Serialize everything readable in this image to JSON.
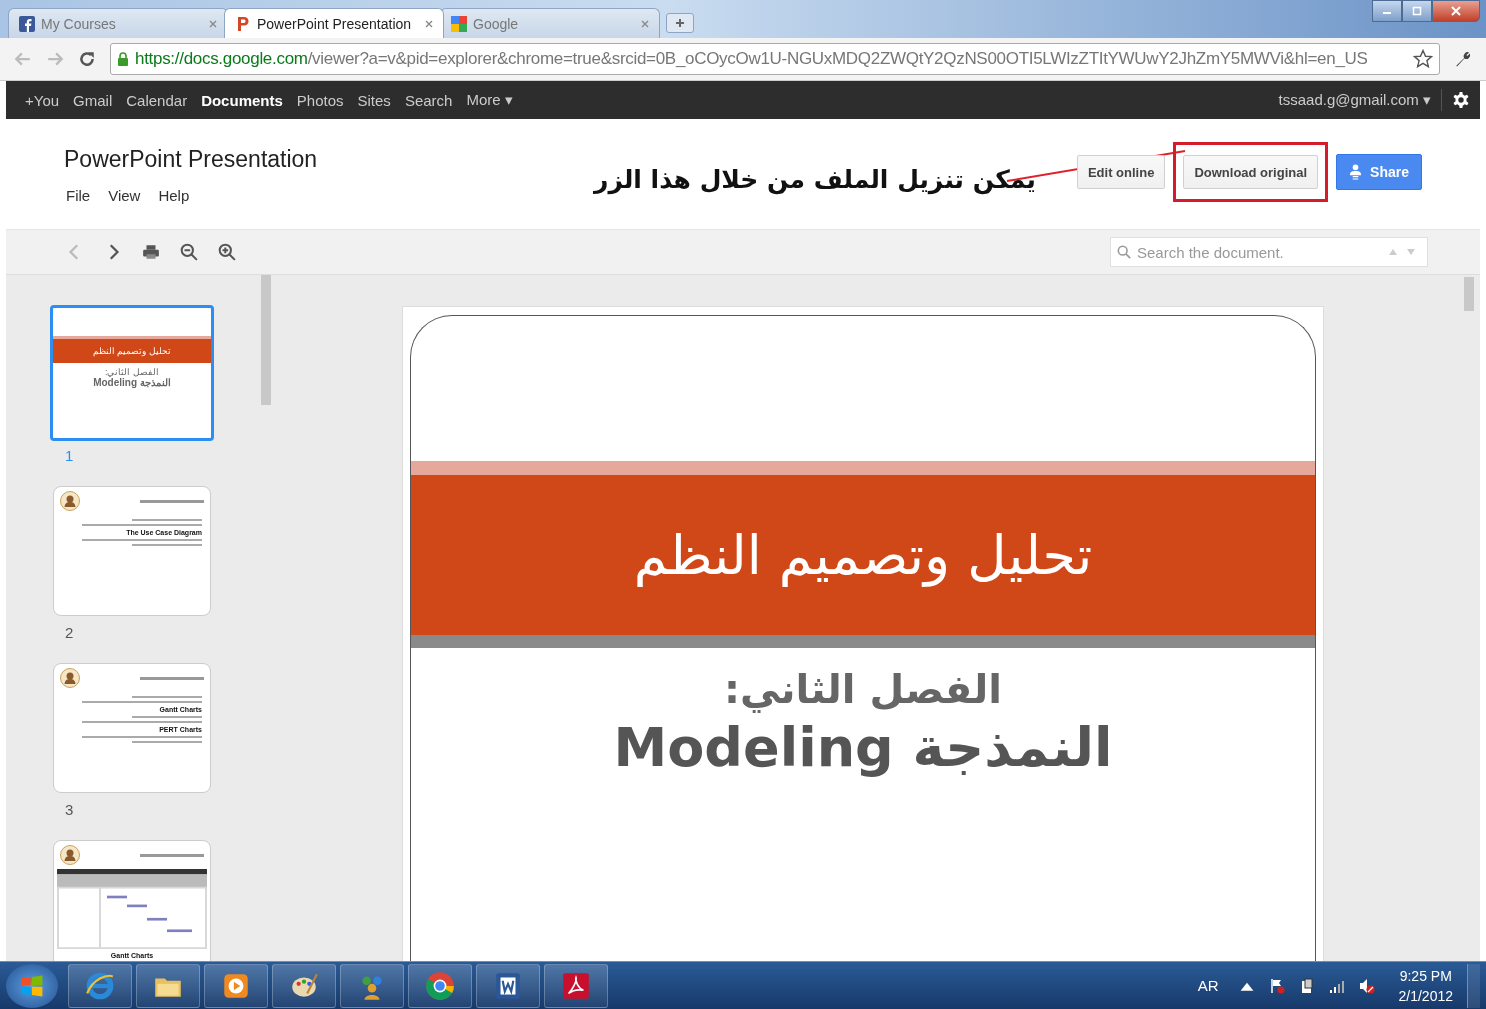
{
  "browser_tabs": [
    {
      "title": "My Courses",
      "kind": "social",
      "selected": false
    },
    {
      "title": "PowerPoint Presentation",
      "kind": "presentation",
      "selected": true
    },
    {
      "title": "Google",
      "kind": "search",
      "selected": false
    }
  ],
  "address_bar": {
    "host": "https://docs.google.com",
    "path": "/viewer?a=v&pid=explorer&chrome=true&srcid=0B_oCOycOw1U-NGUxMDQ2ZWQtY2QzNS00OTI5LWIzZTItYWUwY2JhZmY5MWVi&hl=en_US"
  },
  "google_bar": {
    "links": [
      {
        "label": "+You",
        "selected": false
      },
      {
        "label": "Gmail",
        "selected": false
      },
      {
        "label": "Calendar",
        "selected": false
      },
      {
        "label": "Documents",
        "selected": true
      },
      {
        "label": "Photos",
        "selected": false
      },
      {
        "label": "Sites",
        "selected": false
      },
      {
        "label": "Search",
        "selected": false
      },
      {
        "label": "More ▾",
        "selected": false
      }
    ],
    "account": "tssaad.g@gmail.com ▾"
  },
  "document": {
    "title": "PowerPoint Presentation",
    "menu": [
      "File",
      "View",
      "Help"
    ]
  },
  "annotation": "يمكن تنزيل الملف من خلال هذا الزر",
  "buttons": {
    "edit": "Edit online",
    "download": "Download original",
    "share": "Share"
  },
  "search": {
    "placeholder": "Search the document."
  },
  "thumbnails": [
    {
      "number": "1",
      "kind": "title",
      "selected": true,
      "title": "تحليل وتصميم النظم",
      "line_1": "الفصل الثاني:",
      "line_2": "النمذجة Modeling"
    },
    {
      "number": "2",
      "kind": "bullets",
      "selected": false,
      "items": [
        "The Use Case Diagram"
      ]
    },
    {
      "number": "3",
      "kind": "bullets",
      "selected": false,
      "items": [
        "Gantt Charts",
        "PERT Charts"
      ]
    },
    {
      "kind": "picture",
      "selected": false,
      "items": [
        "Gantt Charts"
      ]
    }
  ],
  "slide": {
    "title": "تحليل وتصميم النظم",
    "line_1": "الفصل الثاني:",
    "line_2": "النمذجة Modeling"
  },
  "taskbar": {
    "apps": [
      {
        "kind": "start"
      },
      {
        "kind": "browser"
      },
      {
        "kind": "folder"
      },
      {
        "kind": "media"
      },
      {
        "kind": "paint"
      },
      {
        "kind": "people"
      },
      {
        "kind": "chrome"
      },
      {
        "kind": "word"
      },
      {
        "kind": "pdf"
      }
    ],
    "language": "AR",
    "time": "9:25 PM",
    "date": "2/1/2012"
  }
}
